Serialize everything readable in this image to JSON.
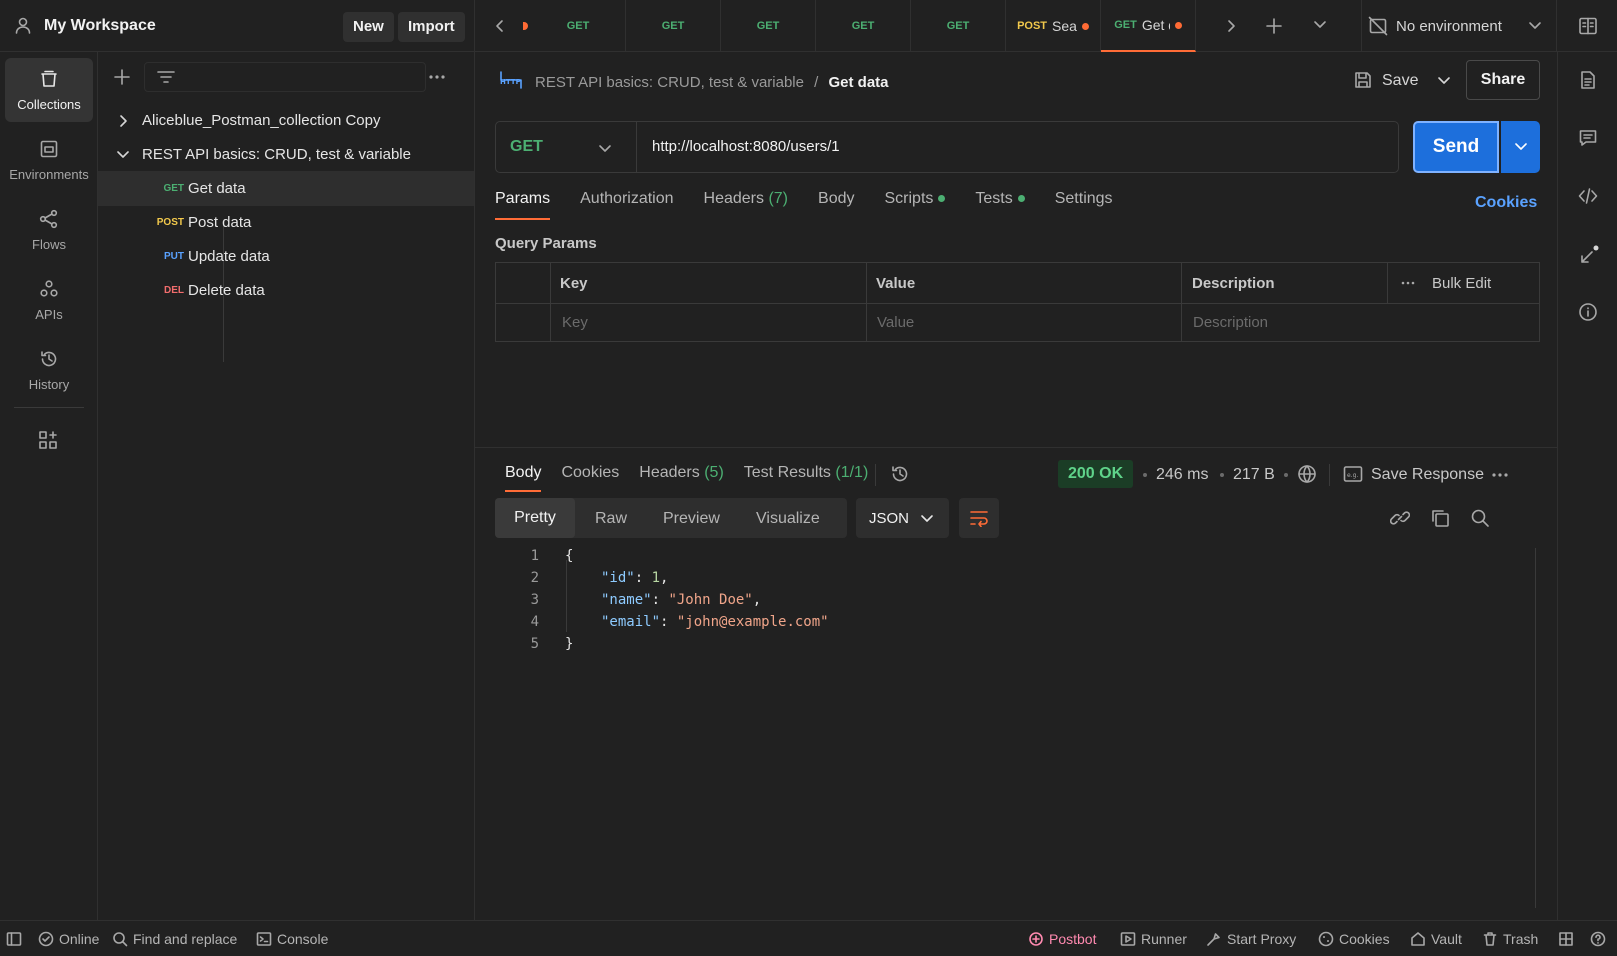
{
  "workspace": {
    "name": "My Workspace",
    "new_label": "New",
    "import_label": "Import"
  },
  "tabs": [
    {
      "method": "GET"
    },
    {
      "method": "GET"
    },
    {
      "method": "GET"
    },
    {
      "method": "GET"
    },
    {
      "method": "GET"
    },
    {
      "method": "POST",
      "name": "Sea",
      "unsaved": true
    },
    {
      "method": "GET",
      "name": "Get d",
      "unsaved": true,
      "active": true
    }
  ],
  "environment": {
    "label": "No environment"
  },
  "rail": {
    "collections": "Collections",
    "environments": "Environments",
    "flows": "Flows",
    "apis": "APIs",
    "history": "History"
  },
  "sidebar": {
    "collections": [
      {
        "name": "Aliceblue_Postman_collection Copy",
        "expanded": false
      },
      {
        "name": "REST API basics: CRUD, test & variable",
        "expanded": true
      }
    ],
    "requests": [
      {
        "method": "GET",
        "name": "Get data"
      },
      {
        "method": "POST",
        "name": "Post data"
      },
      {
        "method": "PUT",
        "name": "Update data"
      },
      {
        "method": "DEL",
        "name": "Delete data"
      }
    ]
  },
  "request": {
    "breadcrumb_collection": "REST API basics: CRUD, test & variable",
    "breadcrumb_sep": "/",
    "title": "Get data",
    "save_label": "Save",
    "share_label": "Share",
    "method": "GET",
    "url": "http://localhost:8080/users/1",
    "send_label": "Send",
    "tabs": {
      "params": "Params",
      "authorization": "Authorization",
      "headers": "Headers",
      "headers_count": "(7)",
      "body": "Body",
      "scripts": "Scripts",
      "tests": "Tests",
      "settings": "Settings"
    },
    "cookies_label": "Cookies",
    "query_params_title": "Query Params",
    "table": {
      "key": "Key",
      "value": "Value",
      "description": "Description",
      "bulk_edit": "Bulk Edit",
      "key_placeholder": "Key",
      "value_placeholder": "Value",
      "description_placeholder": "Description"
    }
  },
  "response": {
    "tabs": {
      "body": "Body",
      "cookies": "Cookies",
      "headers": "Headers",
      "headers_count": "(5)",
      "test_results": "Test Results",
      "test_count": "(1/1)"
    },
    "status": "200 OK",
    "time": "246 ms",
    "size": "217 B",
    "save_response": "Save Response",
    "views": {
      "pretty": "Pretty",
      "raw": "Raw",
      "preview": "Preview",
      "visualize": "Visualize"
    },
    "format": "JSON",
    "body_lines": [
      {
        "n": "1",
        "open": "{"
      },
      {
        "n": "2",
        "key": "\"id\"",
        "value": "1",
        "type": "num"
      },
      {
        "n": "3",
        "key": "\"name\"",
        "value": "\"John Doe\"",
        "type": "str"
      },
      {
        "n": "4",
        "key": "\"email\"",
        "value": "\"john@example.com\"",
        "type": "str"
      },
      {
        "n": "5",
        "close": "}"
      }
    ]
  },
  "statusbar": {
    "online": "Online",
    "find_replace": "Find and replace",
    "console": "Console",
    "postbot": "Postbot",
    "runner": "Runner",
    "start_proxy": "Start Proxy",
    "cookies": "Cookies",
    "vault": "Vault",
    "trash": "Trash"
  },
  "colors": {
    "accent": "#ff6c37",
    "send": "#1d6fdc",
    "get": "#4caf72",
    "post": "#f2c94c",
    "put": "#5aa2ff",
    "delete": "#f26d6d",
    "postbot": "#ff8ab0"
  }
}
